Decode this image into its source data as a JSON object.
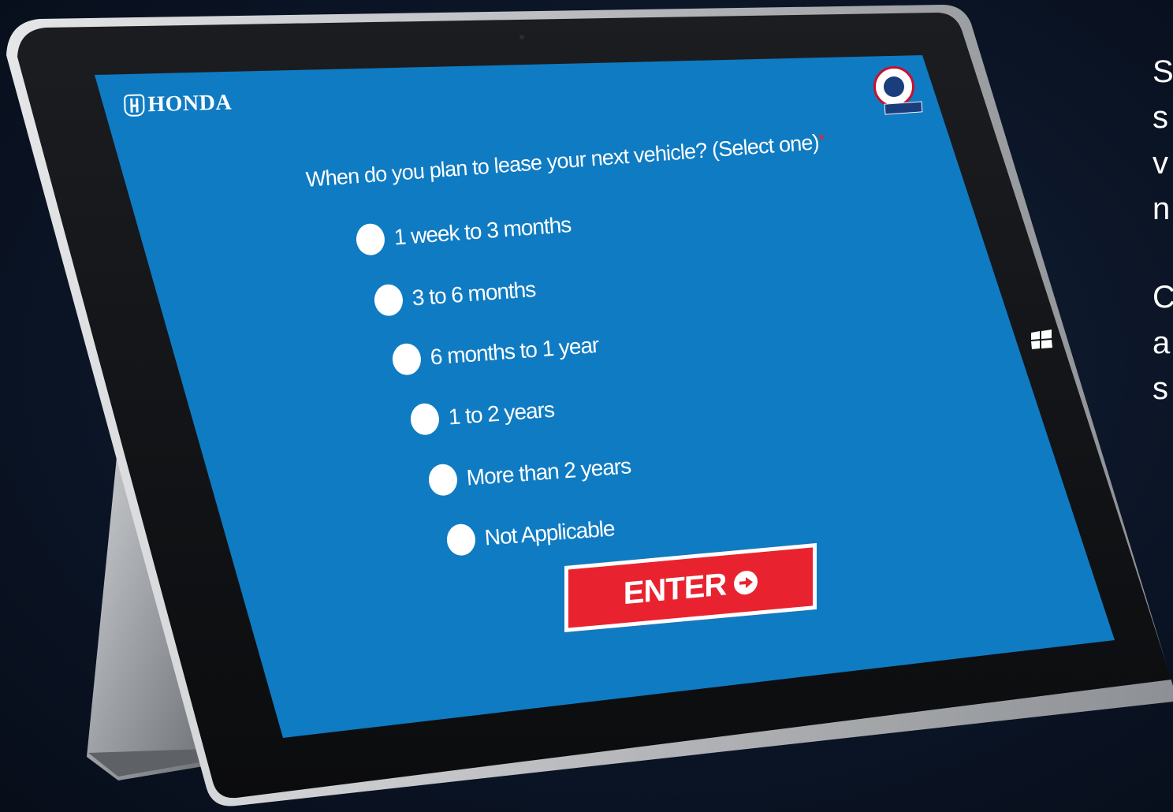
{
  "side_text": {
    "line1": "S",
    "line2": "s",
    "line3": "v",
    "line4": "n",
    "line5": "C",
    "line6": "a",
    "line7": "s"
  },
  "screen": {
    "brand": "HONDA",
    "question": "When do you plan to lease your next vehicle? (Select one)",
    "required_marker": "*",
    "options": [
      {
        "label": "1 week to 3 months"
      },
      {
        "label": "3 to 6 months"
      },
      {
        "label": "6 months to 1 year"
      },
      {
        "label": "1 to 2 years"
      },
      {
        "label": "More than 2 years"
      },
      {
        "label": "Not Applicable"
      }
    ],
    "submit_label": "ENTER"
  },
  "colors": {
    "screen_bg": "#0f7bc2",
    "button_red": "#e8232f",
    "page_bg": "#0c1628"
  },
  "icons": {
    "submit": "arrow-circle-right-icon",
    "os_button": "windows-logo-icon",
    "badge": "honda-badge-icon"
  }
}
